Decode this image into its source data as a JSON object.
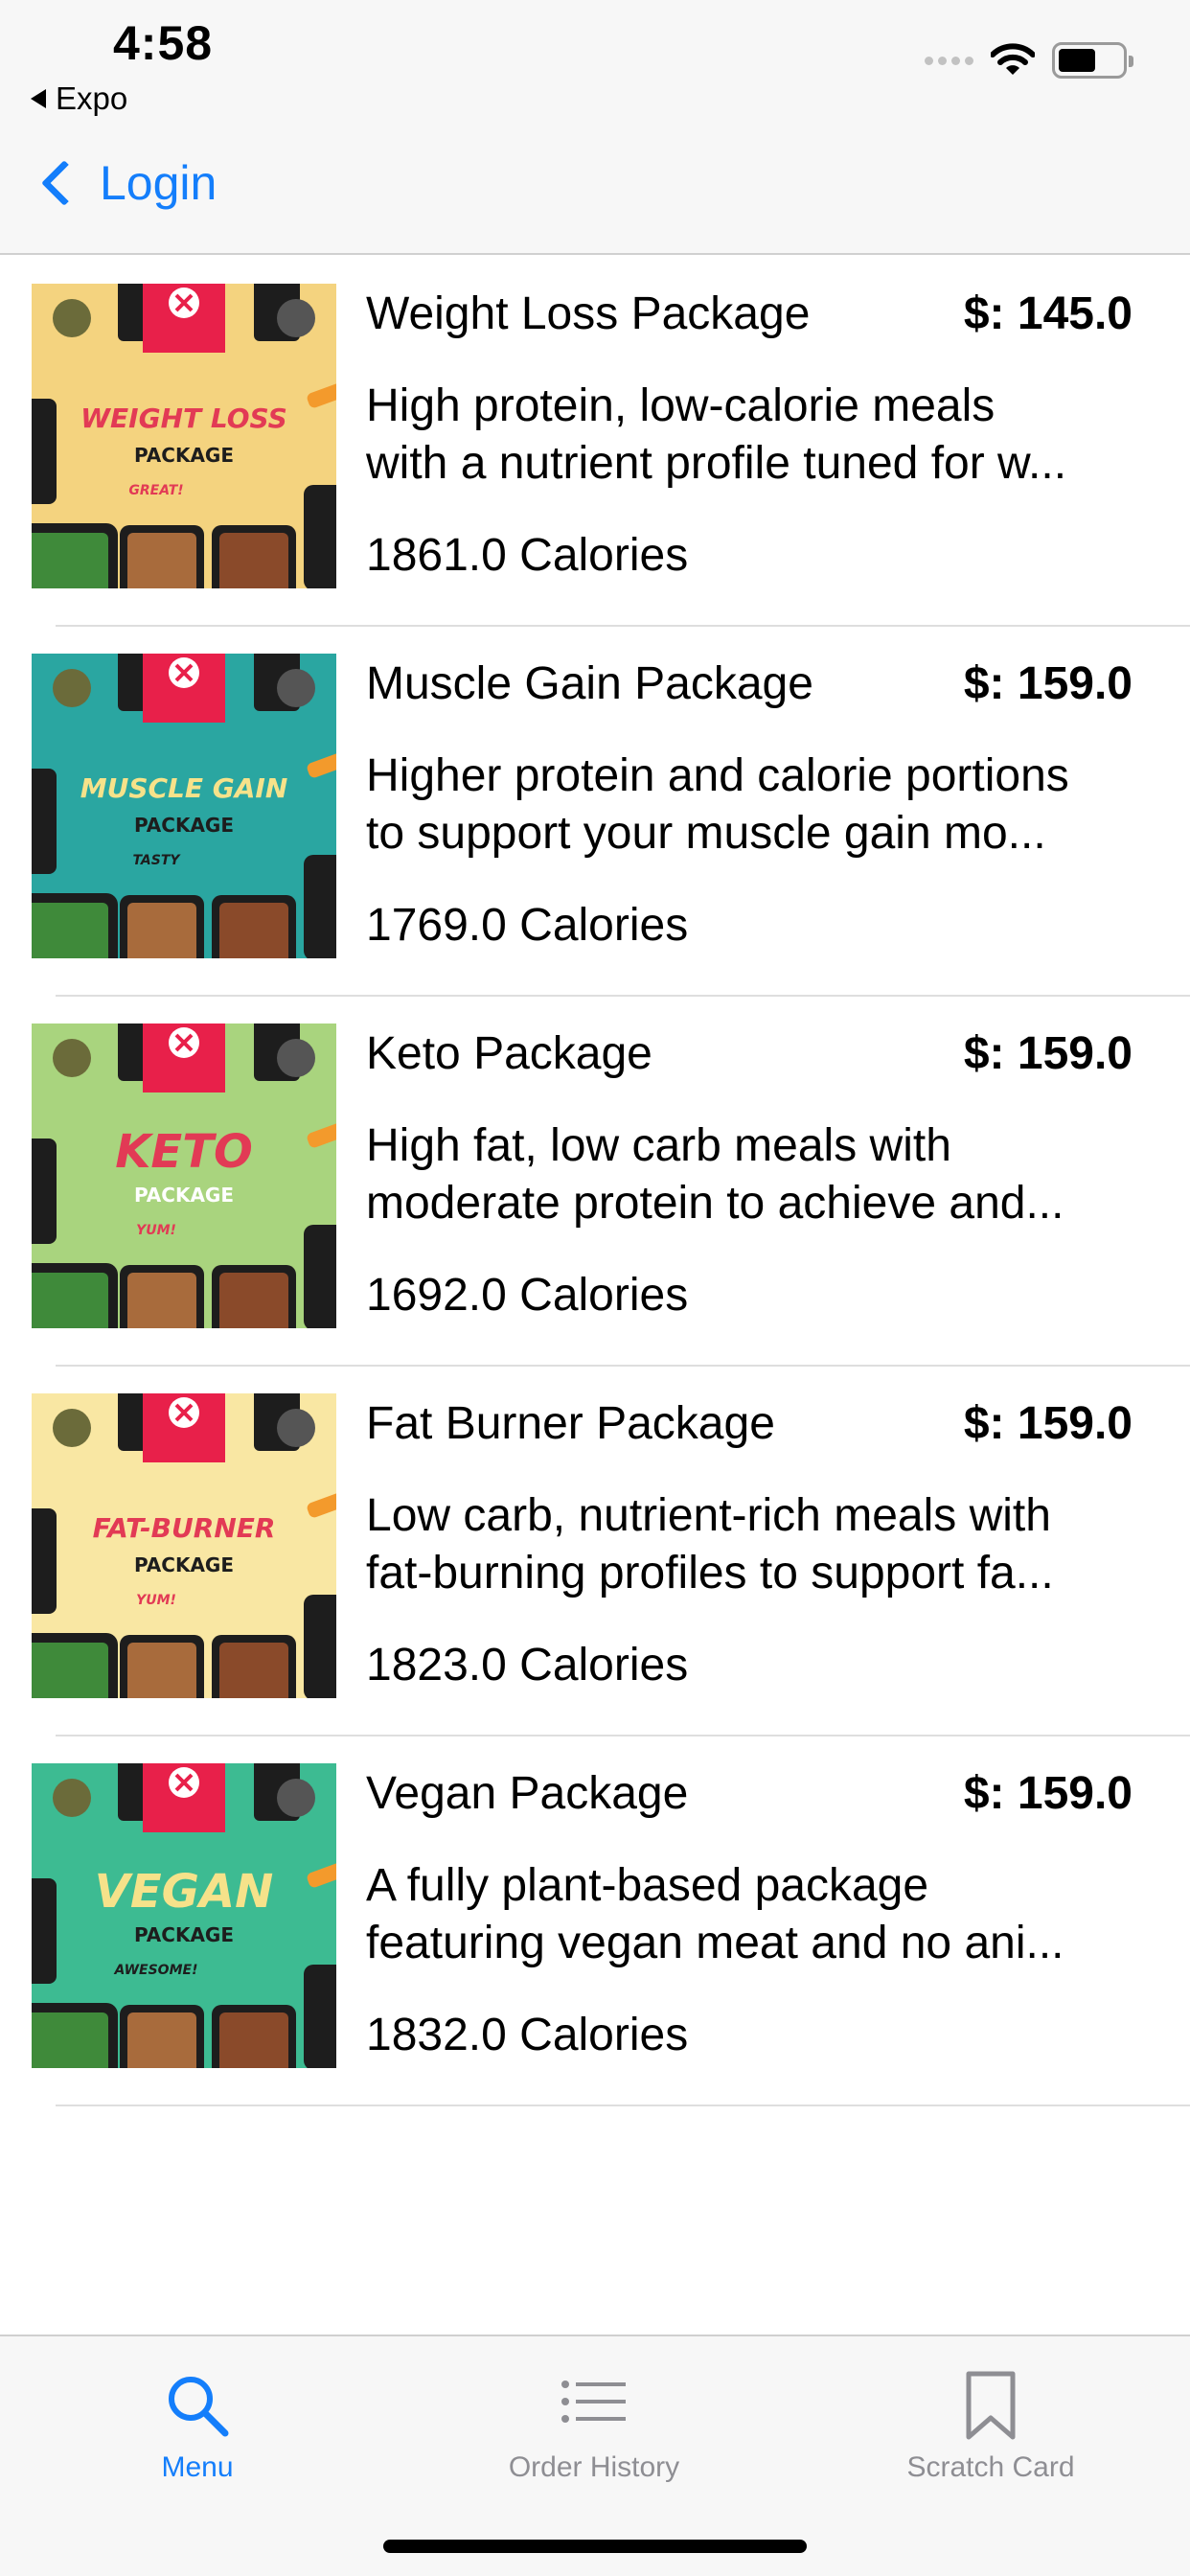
{
  "status_bar": {
    "time": "4:58",
    "back_app": "Expo"
  },
  "nav": {
    "back_label": "Login"
  },
  "packages": [
    {
      "title": "Weight Loss Package",
      "price": "$: 145.0",
      "desc_line1": "High protein, low-calorie meals",
      "desc_line2": "with a nutrient profile tuned for w...",
      "calories": "1861.0 Calories",
      "image": {
        "bg": "#f4d37f",
        "label_top": "WEIGHT LOSS",
        "label_bottom": "PACKAGE",
        "accent": "#e23a55",
        "tag": "GREAT!"
      }
    },
    {
      "title": "Muscle Gain Package",
      "price": "$: 159.0",
      "desc_line1": "Higher protein and calorie portions",
      "desc_line2": "to support your muscle gain mo...",
      "calories": "1769.0 Calories",
      "image": {
        "bg": "#2aa6a1",
        "label_top": "MUSCLE GAIN",
        "label_bottom": "PACKAGE",
        "accent": "#f6e28a",
        "tag": "TASTY"
      }
    },
    {
      "title": "Keto Package",
      "price": "$: 159.0",
      "desc_line1": "High fat, low carb meals with",
      "desc_line2": "moderate protein to achieve and...",
      "calories": "1692.0 Calories",
      "image": {
        "bg": "#a9d47e",
        "label_top": "KETO",
        "label_bottom": "PACKAGE",
        "accent": "#e23a55",
        "tag": "YUM!"
      }
    },
    {
      "title": "Fat Burner Package",
      "price": "$: 159.0",
      "desc_line1": "Low carb, nutrient-rich meals with",
      "desc_line2": "fat-burning profiles to support fa...",
      "calories": "1823.0 Calories",
      "image": {
        "bg": "#f9e7a3",
        "label_top": "FAT-BURNER",
        "label_bottom": "PACKAGE",
        "accent": "#e23a55",
        "tag": "YUM!"
      }
    },
    {
      "title": "Vegan Package",
      "price": "$: 159.0",
      "desc_line1": "A fully plant-based package",
      "desc_line2": "featuring vegan meat and no ani...",
      "calories": "1832.0 Calories",
      "image": {
        "bg": "#3dbb92",
        "label_top": "VEGAN",
        "label_bottom": "PACKAGE",
        "accent": "#f6e28a",
        "tag": "AWESOME!"
      }
    }
  ],
  "tabbar": {
    "items": [
      {
        "label": "Menu",
        "icon": "search-icon",
        "active": true
      },
      {
        "label": "Order History",
        "icon": "list-icon",
        "active": false
      },
      {
        "label": "Scratch Card",
        "icon": "bookmark-icon",
        "active": false
      }
    ],
    "active_color": "#147efb",
    "inactive_color": "#8e8e93"
  }
}
